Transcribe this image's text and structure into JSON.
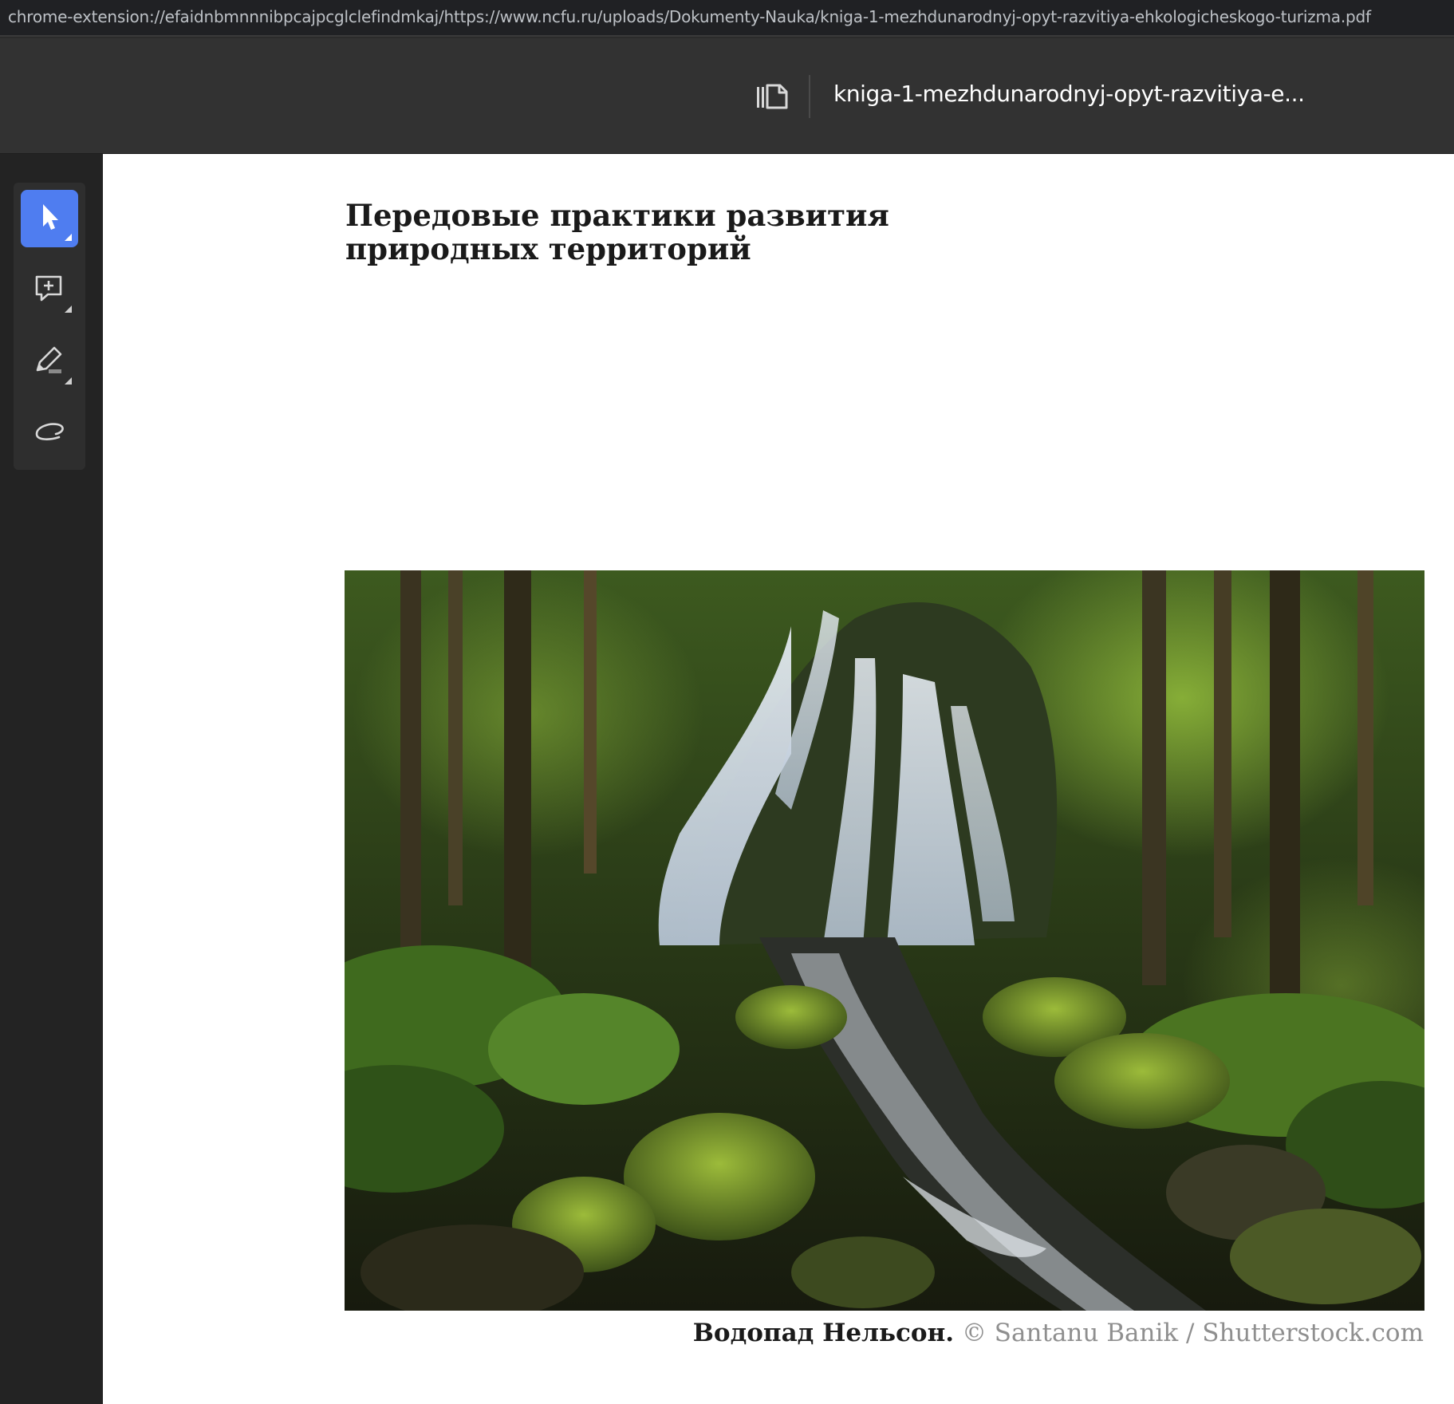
{
  "browser": {
    "url": "chrome-extension://efaidnbmnnnibpcajpcglclefindmkaj/https://www.ncfu.ru/uploads/Dokumenty-Nauka/kniga-1-mezhdunarodnyj-opyt-razvitiya-ehkologicheskogo-turizma.pdf"
  },
  "toolbar": {
    "panel_icon": "document-panels-icon",
    "doc_title": "kniga-1-mezhdunarodnyj-opyt-razvitiya-e..."
  },
  "tools": [
    {
      "icon": "cursor-icon",
      "active": true
    },
    {
      "icon": "add-comment-icon",
      "active": false
    },
    {
      "icon": "draw-pencil-icon",
      "active": false
    },
    {
      "icon": "freehand-lasso-icon",
      "active": false
    }
  ],
  "page": {
    "heading_line1": "Передовые практики развития",
    "heading_line2": "природных территорий",
    "caption_bold": "Водопад Нельсон.",
    "caption_credit": " © Santanu Banik / Shutterstock.com"
  },
  "colors": {
    "accent": "#4f7df0",
    "toolbar_bg": "#323232",
    "rail_bg": "#232323"
  }
}
